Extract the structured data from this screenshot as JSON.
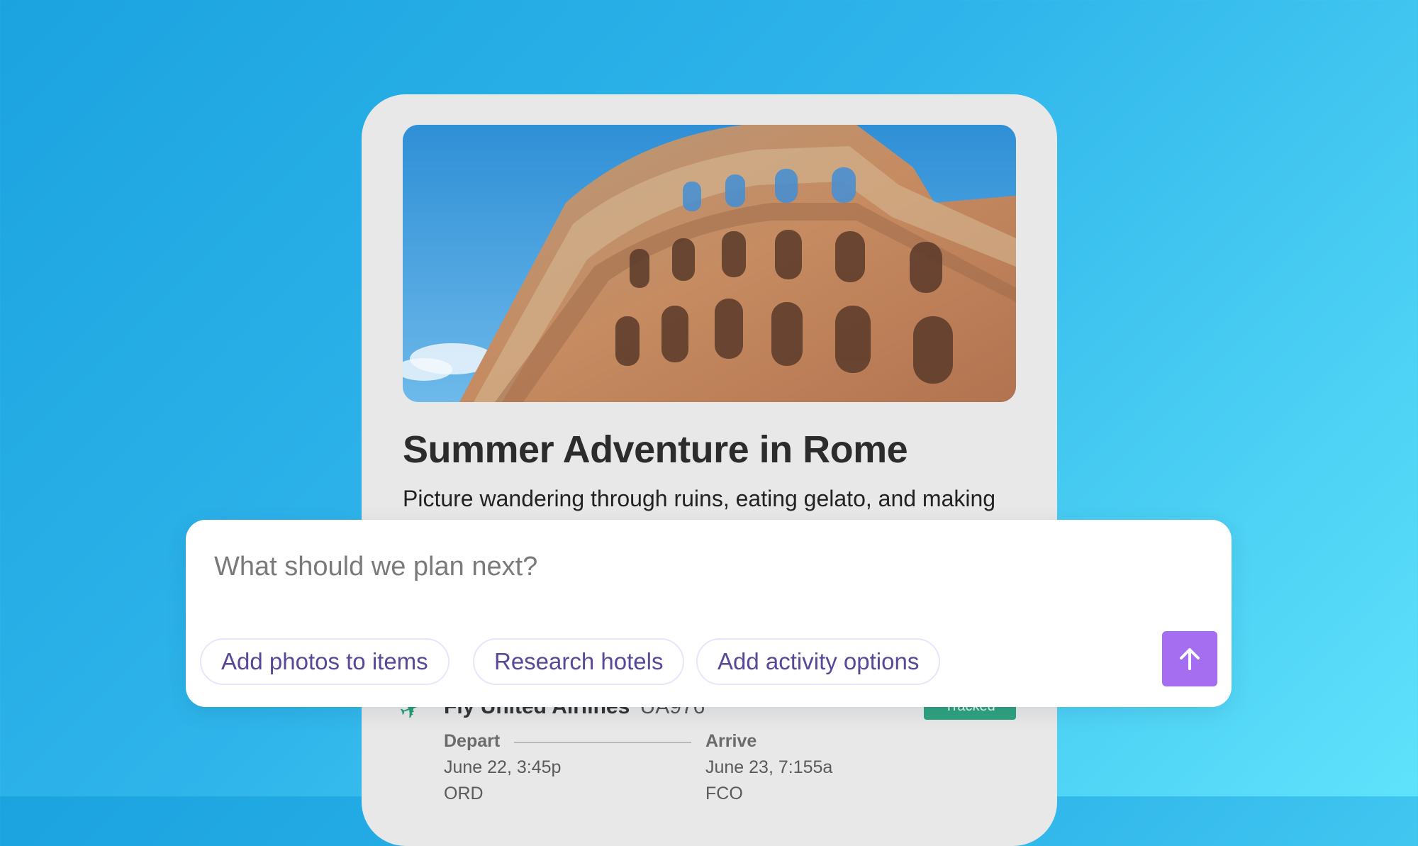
{
  "trip": {
    "title": "Summer Adventure in Rome",
    "description": "Picture wandering through ruins, eating gelato, and making",
    "hero_image_alt": "Colosseum"
  },
  "flight": {
    "name": "Fly United Airlines",
    "code": "UA976",
    "status": "Tracked",
    "depart_label": "Depart",
    "depart_time": "June 22, 3:45p",
    "depart_code": "ORD",
    "arrive_label": "Arrive",
    "arrive_time": "June 23, 7:155a",
    "arrive_code": "FCO"
  },
  "prompt": {
    "placeholder": "What should we plan next?",
    "value": "",
    "suggestions": [
      "Add photos to items",
      "Research hotels",
      "Add activity options"
    ],
    "send_icon": "arrow-up-icon"
  },
  "colors": {
    "accent": "#a56df0",
    "chip_text": "#5b4797",
    "tracked": "#2fa37f"
  }
}
